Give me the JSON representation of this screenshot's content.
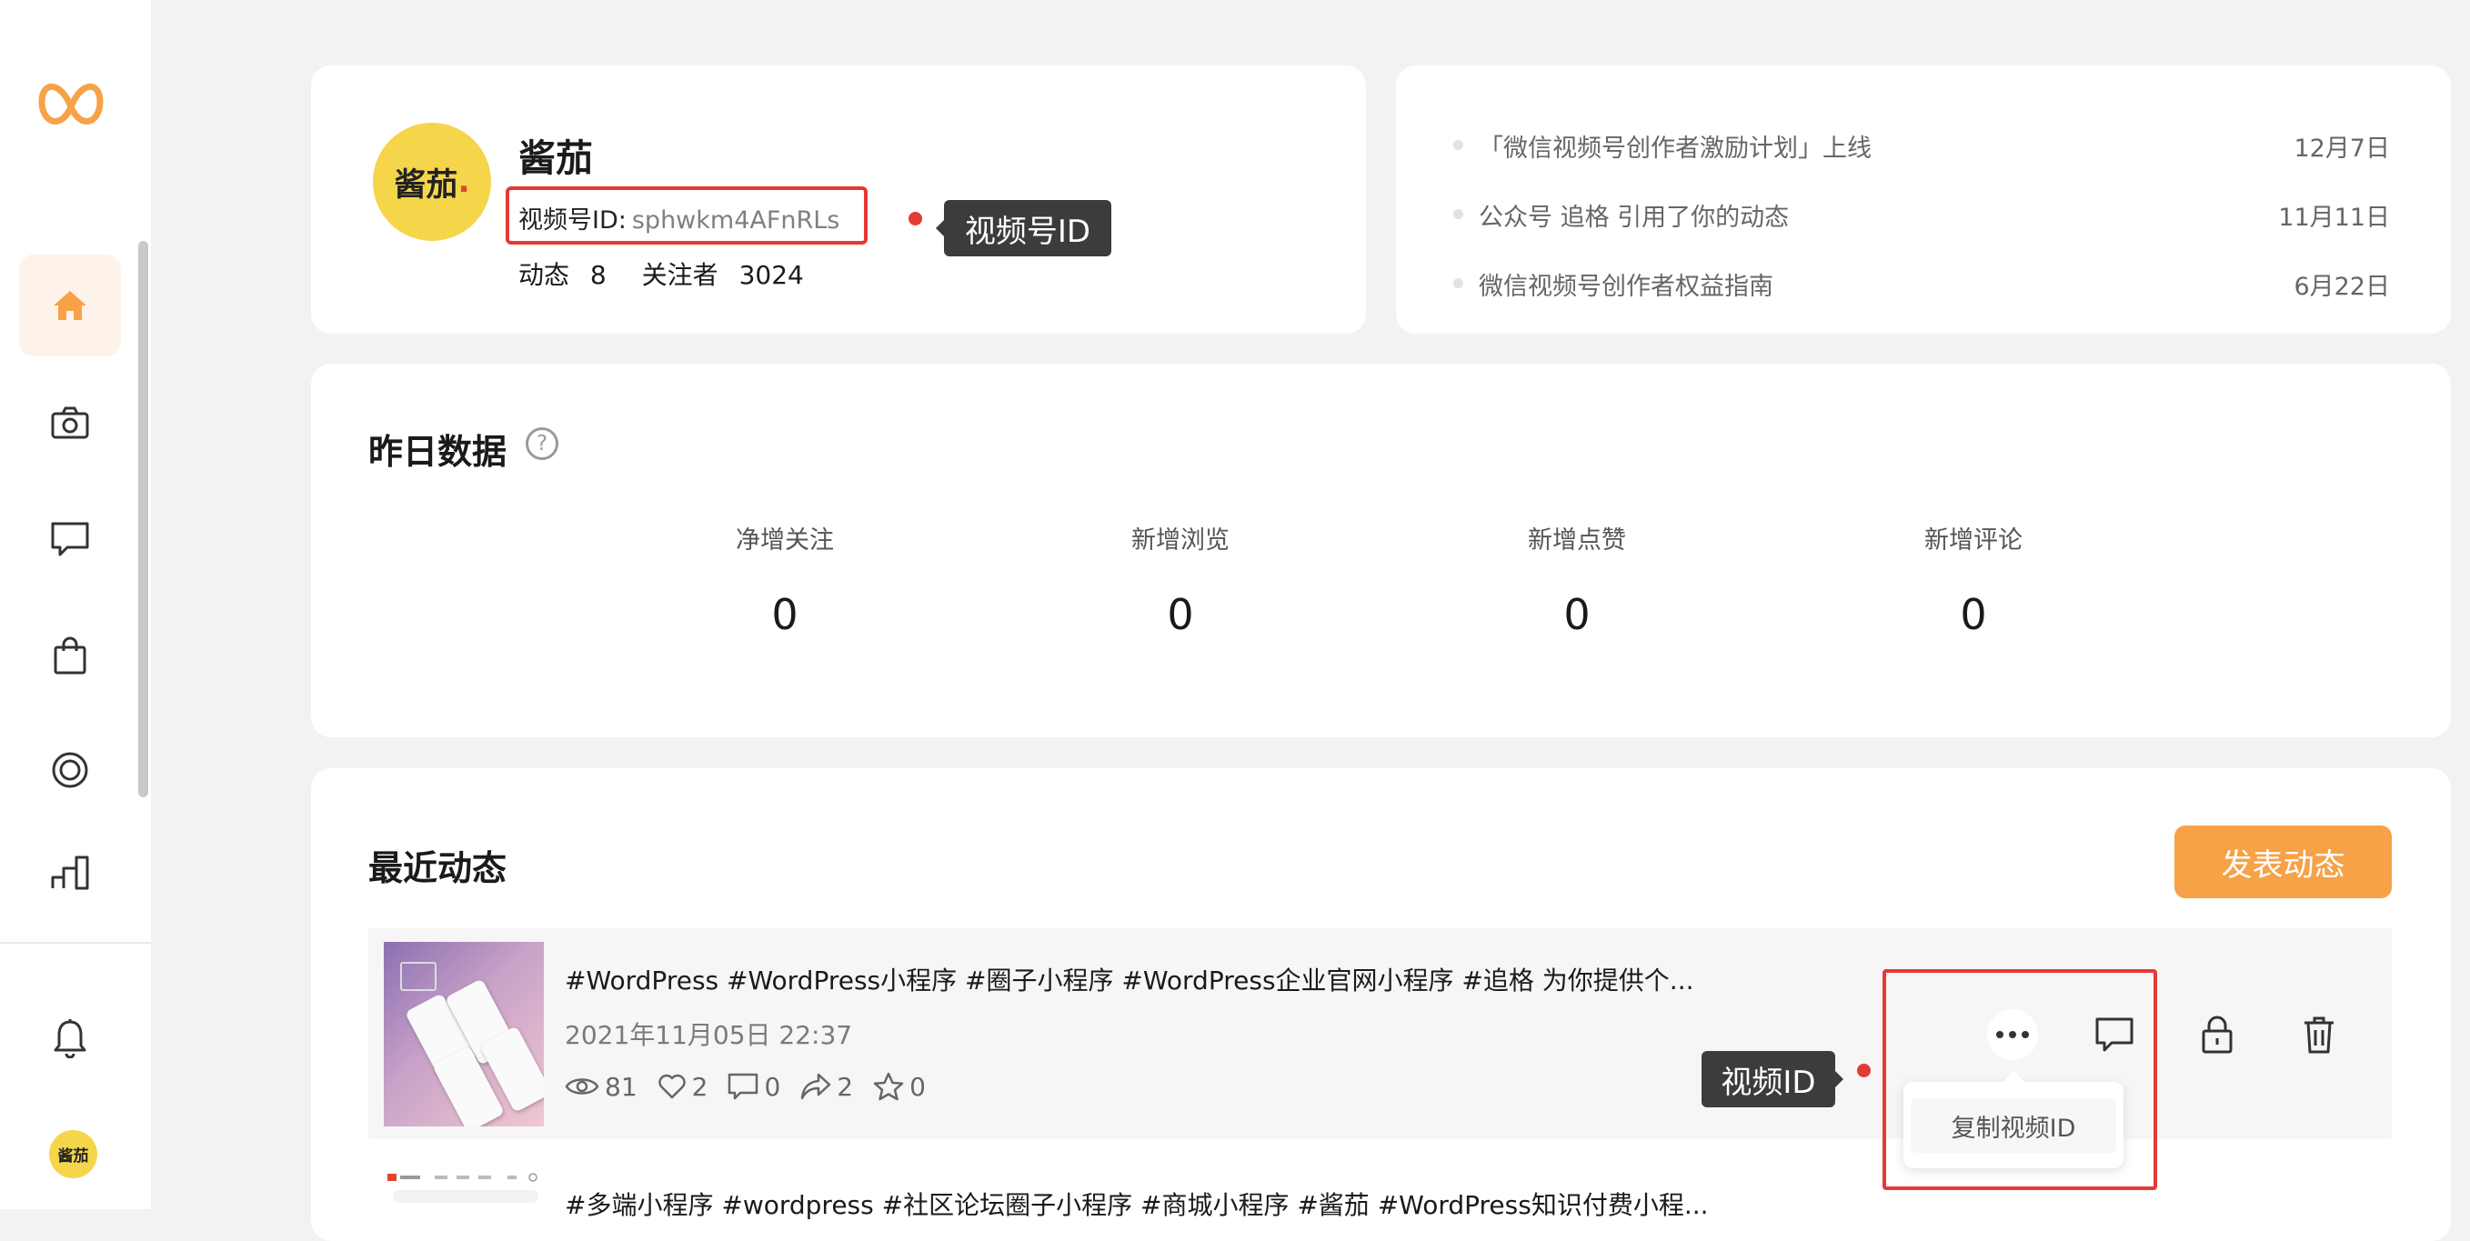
{
  "sidebar": {
    "nav": [
      {
        "name": "home",
        "icon": "home-icon",
        "active": true
      },
      {
        "name": "camera",
        "icon": "camera-icon"
      },
      {
        "name": "comments",
        "icon": "comment-icon"
      },
      {
        "name": "shop",
        "icon": "shopping-bag-icon"
      },
      {
        "name": "live",
        "icon": "live-circle-icon"
      },
      {
        "name": "data",
        "icon": "bar-chart-icon"
      }
    ],
    "bell_icon": "bell-icon",
    "avatar_text": "酱茄"
  },
  "profile": {
    "avatar_text": "酱茄",
    "avatar_dot": ".",
    "nickname": "酱茄",
    "channel_id_label": "视频号ID:",
    "channel_id_value": "sphwkm4AFnRLs",
    "posts_label": "动态",
    "posts_count": "8",
    "followers_label": "关注者",
    "followers_count": "3024",
    "annotation": "视频号ID"
  },
  "notices": [
    {
      "text": "「微信视频号创作者激励计划」上线",
      "date": "12月7日"
    },
    {
      "text": "公众号 追格 引用了你的动态",
      "date": "11月11日"
    },
    {
      "text": "微信视频号创作者权益指南",
      "date": "6月22日"
    }
  ],
  "yesterday": {
    "title": "昨日数据",
    "help_icon": "?",
    "metrics": [
      {
        "label": "净增关注",
        "value": "0"
      },
      {
        "label": "新增浏览",
        "value": "0"
      },
      {
        "label": "新增点赞",
        "value": "0"
      },
      {
        "label": "新增评论",
        "value": "0"
      }
    ]
  },
  "recent": {
    "title": "最近动态",
    "publish_label": "发表动态",
    "posts": [
      {
        "title": "#WordPress #WordPress小程序 #圈子小程序 #WordPress企业官网小程序 #追格 为你提供个...",
        "date": "2021年11月05日 22:37",
        "views": "81",
        "likes": "2",
        "comments": "0",
        "shares": "2",
        "favorites": "0"
      },
      {
        "title": "#多端小程序 #wordpress #社区论坛圈子小程序 #商城小程序 #酱茄 #WordPress知识付费小程..."
      }
    ],
    "video_id_annotation": "视频ID",
    "menu": {
      "copy_video_id": "复制视频ID"
    }
  },
  "colors": {
    "accent": "#f7a247",
    "highlight": "#e53935",
    "avatar": "#f5d54a",
    "background": "#f2f2f2"
  }
}
